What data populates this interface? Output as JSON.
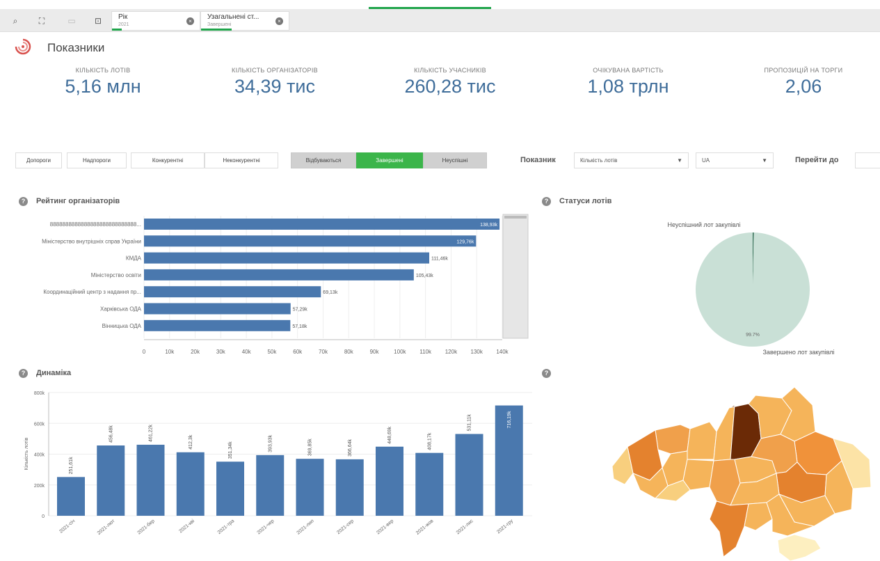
{
  "toolbar": {
    "icons": [
      "search-select-icon",
      "step-back-icon",
      "step-forward-icon",
      "clear-selections-icon"
    ]
  },
  "selections": [
    {
      "label": "Рік",
      "value": "2021"
    },
    {
      "label": "Узагальнені ст...",
      "value": "Завершені"
    }
  ],
  "header": {
    "title": "Показники"
  },
  "kpis": [
    {
      "label": "КІЛЬКІСТЬ ЛОТІВ",
      "value": "5,16 млн"
    },
    {
      "label": "КІЛЬКІСТЬ ОРГАНІЗАТОРІВ",
      "value": "34,39 тис"
    },
    {
      "label": "КІЛЬКІСТЬ УЧАСНИКІВ",
      "value": "260,28 тис"
    },
    {
      "label": "ОЧІКУВАНА ВАРТІСТЬ",
      "value": "1,08 трлн"
    },
    {
      "label": "ПРОПОЗИЦІЙ НА ТОРГИ",
      "value": "2,06"
    }
  ],
  "filters": {
    "buttons": [
      "Допороги",
      "Надпороги",
      "Конкурентні",
      "Неконкурентні",
      "Відбуваються",
      "Завершені",
      "Неуспішні"
    ],
    "indicator_label": "Показник",
    "indicator_value": "Кількість лотів",
    "region_value": "UA",
    "goto_label": "Перейти до",
    "goto_value": ""
  },
  "colors": {
    "bar": "#4a78ae",
    "accent_green": "#3bb54a",
    "pie": "#c9e0d6",
    "map_dark": "#6b2a06"
  },
  "ranking": {
    "title": "Рейтинг організаторів",
    "chart_data": {
      "type": "bar",
      "orientation": "horizontal",
      "categories": [
        "8888888888888888888888888888...",
        "Міністерство внутрішніх справ України",
        "КМДА",
        "Міністерство освіти",
        "Координаційний центр з надання пр...",
        "Харківська ОДА",
        "Вінницька ОДА"
      ],
      "values": [
        138.93,
        129.76,
        111.46,
        105.43,
        69.13,
        57.29,
        57.18
      ],
      "labels": [
        "138,93k",
        "129,76k",
        "111,46k",
        "105,43k",
        "69,13k",
        "57,29k",
        "57,18k"
      ],
      "xticks": [
        "0",
        "10k",
        "20k",
        "30k",
        "40k",
        "50k",
        "60k",
        "70k",
        "80k",
        "90k",
        "100k",
        "110k",
        "120k",
        "130k",
        "140k"
      ],
      "xlim": [
        0,
        140
      ]
    }
  },
  "status": {
    "title": "Статуси лотів",
    "chart_data": {
      "type": "pie",
      "labels": [
        "Неуспішний лот закупівлі",
        "Завершено лот закупівлі"
      ],
      "values": [
        0.3,
        99.7
      ],
      "slice_label": "99.7%"
    }
  },
  "dynamics": {
    "title": "Динаміка",
    "chart_data": {
      "type": "bar",
      "categories": [
        "2021-січ",
        "2021-лют",
        "2021-бер",
        "2021-кві",
        "2021-тра",
        "2021-чер",
        "2021-лип",
        "2021-сер",
        "2021-вер",
        "2021-жов",
        "2021-лис",
        "2021-гру"
      ],
      "values": [
        251.61,
        456.48,
        461.22,
        412.3,
        351.34,
        393.93,
        369.85,
        366.64,
        448.69,
        408.17,
        531.11,
        716.19
      ],
      "labels": [
        "251,61k",
        "456,48k",
        "461,22k",
        "412,3k",
        "351,34k",
        "393,93k",
        "369,85k",
        "366,64k",
        "448,69k",
        "408,17k",
        "531,11k",
        "716,19k"
      ],
      "yticks": [
        "0",
        "200k",
        "400k",
        "600k",
        "800k"
      ],
      "ylim": [
        0,
        800
      ],
      "ylabel": "Кількість лотів"
    }
  },
  "map": {
    "regions": [
      {
        "id": "volyn",
        "c": "#f0a04b"
      },
      {
        "id": "rivne",
        "c": "#f5b45a"
      },
      {
        "id": "zhytomyr",
        "c": "#f5b45a"
      },
      {
        "id": "kyiv",
        "c": "#6b2a06"
      },
      {
        "id": "chernihiv",
        "c": "#f5b45a"
      },
      {
        "id": "sumy",
        "c": "#f5b45a"
      },
      {
        "id": "kharkiv",
        "c": "#f0923a"
      },
      {
        "id": "luhansk",
        "c": "#fce3a6"
      },
      {
        "id": "lviv",
        "c": "#e4822e"
      },
      {
        "id": "ternopil",
        "c": "#f5b45a"
      },
      {
        "id": "khmelnytskyi",
        "c": "#f5b45a"
      },
      {
        "id": "vinnytsia",
        "c": "#f0a04b"
      },
      {
        "id": "cherkasy",
        "c": "#f5b45a"
      },
      {
        "id": "poltava",
        "c": "#f0a04b"
      },
      {
        "id": "dnipro",
        "c": "#e4822e"
      },
      {
        "id": "donetsk",
        "c": "#f5b45a"
      },
      {
        "id": "zakarpattia",
        "c": "#f8cf7e"
      },
      {
        "id": "ivano",
        "c": "#f5b45a"
      },
      {
        "id": "chernivtsi",
        "c": "#f8cf7e"
      },
      {
        "id": "kirovohrad",
        "c": "#f5b45a"
      },
      {
        "id": "odesa",
        "c": "#e4822e"
      },
      {
        "id": "mykolaiv",
        "c": "#f5b45a"
      },
      {
        "id": "zaporizhzhia",
        "c": "#f5b45a"
      },
      {
        "id": "kherson",
        "c": "#f5b45a"
      },
      {
        "id": "crimea",
        "c": "#fdefc0"
      }
    ]
  }
}
